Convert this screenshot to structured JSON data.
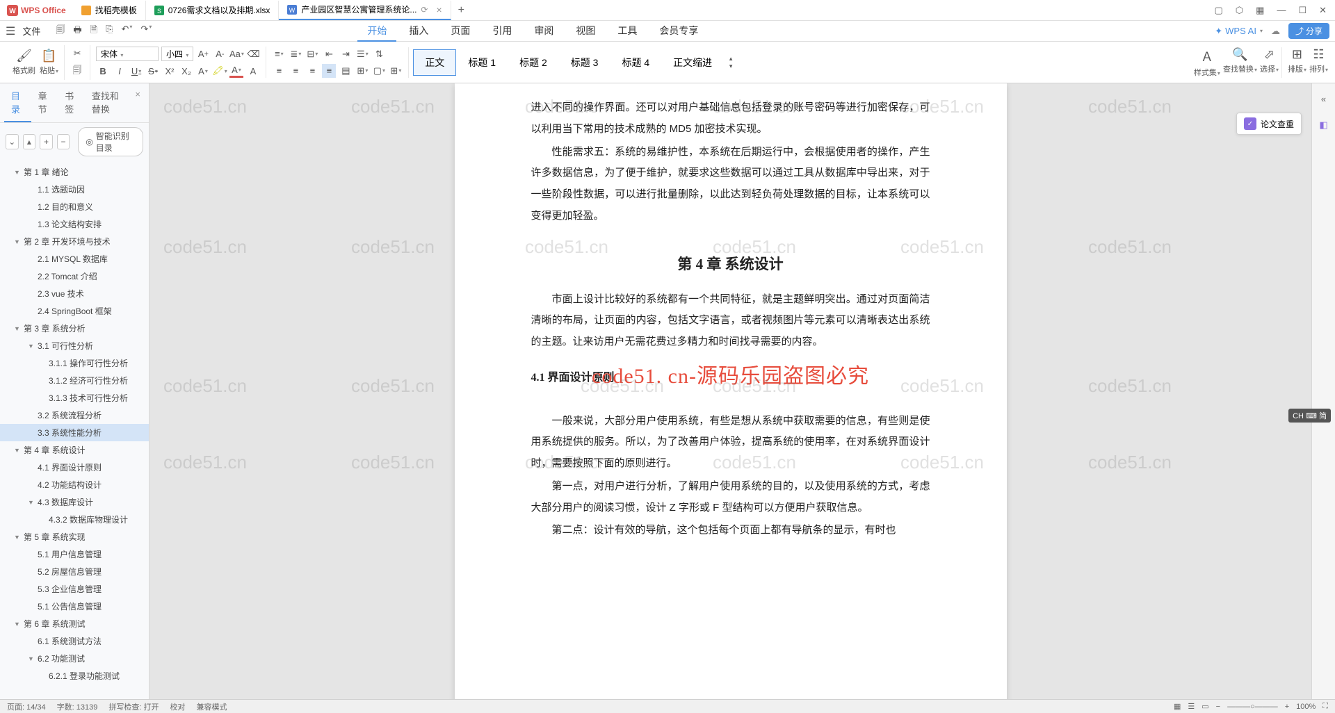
{
  "app": {
    "name": "WPS Office"
  },
  "tabs": [
    {
      "icon": "template",
      "label": "找稻壳模板",
      "color": "#f0a030"
    },
    {
      "icon": "sheet",
      "label": "0726需求文档以及排期.xlsx",
      "color": "#1e9e5a"
    },
    {
      "icon": "doc",
      "label": "产业园区智慧公寓管理系统论...",
      "color": "#4a7dd4",
      "active": true
    }
  ],
  "menu": {
    "file": "文件",
    "tabs": [
      "开始",
      "插入",
      "页面",
      "引用",
      "审阅",
      "视图",
      "工具",
      "会员专享"
    ],
    "active": "开始",
    "ai": "WPS AI",
    "share": "分享"
  },
  "ribbon": {
    "format_brush": "格式刷",
    "paste": "粘贴",
    "font_name": "宋体",
    "font_size": "小四",
    "styles": [
      "正文",
      "标题 1",
      "标题 2",
      "标题 3",
      "标题 4",
      "正文缩进"
    ],
    "active_style": "正文",
    "styleset": "样式集",
    "findreplace": "查找替换",
    "select": "选择",
    "arrange": "排版",
    "sort": "排列"
  },
  "sidebar": {
    "tabs": [
      "目录",
      "章节",
      "书签",
      "查找和替换"
    ],
    "active": "目录",
    "smart_toc": "智能识别目录",
    "toc": [
      {
        "l": 1,
        "t": "第 1 章  绪论",
        "caret": "▼"
      },
      {
        "l": 2,
        "t": "1.1 选题动因"
      },
      {
        "l": 2,
        "t": "1.2 目的和意义"
      },
      {
        "l": 2,
        "t": "1.3 论文结构安排"
      },
      {
        "l": 1,
        "t": "第 2 章  开发环境与技术",
        "caret": "▼"
      },
      {
        "l": 2,
        "t": "2.1 MYSQL 数据库"
      },
      {
        "l": 2,
        "t": "2.2 Tomcat  介绍"
      },
      {
        "l": 2,
        "t": "2.3 vue 技术"
      },
      {
        "l": 2,
        "t": "2.4 SpringBoot 框架"
      },
      {
        "l": 1,
        "t": "第 3 章  系统分析",
        "caret": "▼"
      },
      {
        "l": 2,
        "t": "3.1 可行性分析",
        "caret": "▼"
      },
      {
        "l": 3,
        "t": "3.1.1 操作可行性分析"
      },
      {
        "l": 3,
        "t": "3.1.2 经济可行性分析"
      },
      {
        "l": 3,
        "t": "3.1.3 技术可行性分析"
      },
      {
        "l": 2,
        "t": "3.2 系统流程分析"
      },
      {
        "l": 2,
        "t": "3.3 系统性能分析",
        "selected": true
      },
      {
        "l": 1,
        "t": "第 4 章  系统设计",
        "caret": "▼"
      },
      {
        "l": 2,
        "t": "4.1 界面设计原则"
      },
      {
        "l": 2,
        "t": "4.2 功能结构设计"
      },
      {
        "l": 2,
        "t": "4.3 数据库设计",
        "caret": "▼"
      },
      {
        "l": 3,
        "t": "4.3.2 数据库物理设计"
      },
      {
        "l": 1,
        "t": "第 5 章  系统实现",
        "caret": "▼"
      },
      {
        "l": 2,
        "t": "5.1 用户信息管理"
      },
      {
        "l": 2,
        "t": "5.2 房屋信息管理"
      },
      {
        "l": 2,
        "t": "5.3 企业信息管理"
      },
      {
        "l": 2,
        "t": "5.1 公告信息管理"
      },
      {
        "l": 1,
        "t": "第 6 章  系统测试",
        "caret": "▼"
      },
      {
        "l": 2,
        "t": "6.1 系统测试方法"
      },
      {
        "l": 2,
        "t": "6.2 功能测试",
        "caret": "▼"
      },
      {
        "l": 3,
        "t": "6.2.1 登录功能测试"
      }
    ]
  },
  "document": {
    "p1": "进入不同的操作界面。还可以对用户基础信息包括登录的账号密码等进行加密保存，可以利用当下常用的技术成熟的 MD5 加密技术实现。",
    "p2": "性能需求五：系统的易维护性，本系统在后期运行中，会根据使用者的操作，产生许多数据信息，为了便于维护，就要求这些数据可以通过工具从数据库中导出来，对于一些阶段性数据，可以进行批量删除，以此达到轻负荷处理数据的目标，让本系统可以变得更加轻盈。",
    "chapter": "第 4 章  系统设计",
    "watermark_red": "code51. cn-源码乐园盗图必究",
    "p3": "市面上设计比较好的系统都有一个共同特征，就是主题鲜明突出。通过对页面简洁清晰的布局，让页面的内容，包括文字语言，或者视频图片等元素可以清晰表达出系统的主题。让来访用户无需花费过多精力和时间找寻需要的内容。",
    "section41": "4.1 界面设计原则",
    "p4": "一般来说，大部分用户使用系统，有些是想从系统中获取需要的信息，有些则是使用系统提供的服务。所以，为了改善用户体验，提高系统的使用率，在对系统界面设计时，需要按照下面的原则进行。",
    "p5": "第一点，对用户进行分析，了解用户使用系统的目的，以及使用系统的方式，考虑大部分用户的阅读习惯，设计 Z 字形或 F 型结构可以方便用户获取信息。",
    "p6": "第二点：设计有效的导航，这个包括每个页面上都有导航条的显示，有时也"
  },
  "floating": {
    "check": "论文查重"
  },
  "watermark_bg": "code51.cn",
  "ime": "CH ⌨ 简",
  "statusbar": {
    "page": "页面: 14/34",
    "words": "字数: 13139",
    "spell": "拼写检查: 打开",
    "proof": "校对",
    "mode": "兼容模式",
    "zoom": "100%"
  }
}
